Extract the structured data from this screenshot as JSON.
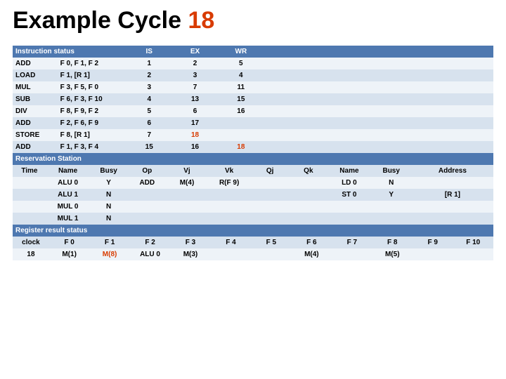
{
  "title_prefix": "Example Cycle ",
  "title_num": "18",
  "instr": {
    "header": [
      "Instruction status",
      "",
      "IS",
      "EX",
      "WR",
      "",
      "",
      "",
      "",
      ""
    ],
    "rows": [
      [
        "ADD",
        "F 0, F 1, F 2",
        "1",
        "2",
        "5",
        "",
        "",
        "",
        "",
        ""
      ],
      [
        "LOAD",
        "F 1, [R 1]",
        "2",
        "3",
        "4",
        "",
        "",
        "",
        "",
        ""
      ],
      [
        "MUL",
        "F 3, F 5, F 0",
        "3",
        "7",
        "11",
        "",
        "",
        "",
        "",
        ""
      ],
      [
        "SUB",
        "F 6, F 3, F 10",
        "4",
        "13",
        "15",
        "",
        "",
        "",
        "",
        ""
      ],
      [
        "DIV",
        "F 8, F 9, F 2",
        "5",
        "6",
        "16",
        "",
        "",
        "",
        "",
        ""
      ],
      [
        "ADD",
        "F 2, F 6, F 9",
        "6",
        "17",
        "",
        "",
        "",
        "",
        "",
        ""
      ],
      [
        "STORE",
        "F 8, [R 1]",
        "7",
        "18",
        "",
        "",
        "",
        "",
        "",
        ""
      ],
      [
        "ADD",
        "F 1, F 3, F 4",
        "15",
        "16",
        "18",
        "",
        "",
        "",
        "",
        ""
      ]
    ],
    "highlights": {
      "6.3": true,
      "7.4": true
    }
  },
  "res": {
    "title": "Reservation Station",
    "header": [
      "Time",
      "Name",
      "Busy",
      "Op",
      "Vj",
      "Vk",
      "Qj",
      "Qk",
      "Name",
      "Busy",
      "Address"
    ],
    "rows": [
      [
        "",
        "ALU 0",
        "Y",
        "ADD",
        "M(4)",
        "R(F 9)",
        "",
        "",
        "LD 0",
        "N",
        ""
      ],
      [
        "",
        "ALU 1",
        "N",
        "",
        "",
        "",
        "",
        "",
        "ST 0",
        "Y",
        "[R 1]"
      ],
      [
        "",
        "MUL 0",
        "N",
        "",
        "",
        "",
        "",
        "",
        "",
        "",
        ""
      ],
      [
        "",
        "MUL 1",
        "N",
        "",
        "",
        "",
        "",
        "",
        "",
        "",
        ""
      ]
    ]
  },
  "reg": {
    "title": "Register result status",
    "header": [
      "clock",
      "F 0",
      "F 1",
      "F 2",
      "F 3",
      "F 4",
      "F 5",
      "F 6",
      "F 7",
      "F 8",
      "F 9",
      "F 10"
    ],
    "rows": [
      [
        "18",
        "M(1)",
        "M(8)",
        "ALU 0",
        "M(3)",
        "",
        "",
        "M(4)",
        "",
        "M(5)",
        "",
        ""
      ]
    ],
    "highlights": {
      "0.2": true
    }
  }
}
